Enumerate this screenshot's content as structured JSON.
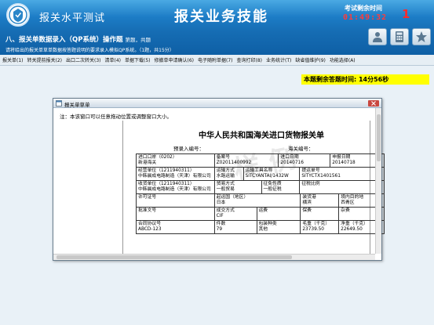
{
  "header": {
    "brand": "报关水平测试",
    "title": "报关业务技能",
    "timer_label": "考试剩余时间",
    "timer_value": "01:49:32",
    "question_number": "1"
  },
  "section": {
    "title": "八、报关单数据录入（QP系统）操作题",
    "meta": "第题，共题",
    "instruction": "请将给出的报关单草单数据按答题说明的要求录入模拟QP系统。（1题，共15分）",
    "tools": [
      "user-icon",
      "calculator-icon",
      "star-icon"
    ]
  },
  "menu": [
    "报关单(1)",
    "转关提前报关(2)",
    "出口二次转关(3)",
    "清单(4)",
    "单据下载(5)",
    "修撤单申请确认(6)",
    "电子随附单据(7)",
    "查询打印(8)",
    "业务统计(T)",
    "缺省值维护(9)",
    "功能选择(A)"
  ],
  "remaining": "本题剩余答题时间:  14分56秒",
  "window": {
    "title": "报关单草单",
    "note": "注：本该窗口可以任意拖动位置或调整窗口大小。",
    "doc_title": "中华人民共和国海关进口货物报关单",
    "pre_entry": "预录入编号：",
    "customs_no": "海关编号：",
    "watermark": "样 例",
    "rows": [
      [
        {
          "label": "进口口岸（0202）",
          "value": "新港海关",
          "w": 100
        },
        {
          "label": "备案号",
          "value": "Z02011400992",
          "w": 82
        },
        {
          "label": "进口日期",
          "value": "20140716",
          "w": 66
        },
        {
          "label": "申报日期",
          "value": "20140718",
          "w": 69
        }
      ],
      [
        {
          "label": "经营单位（1211940311）",
          "value": "中韩晨成电路制造（天津）有限公司",
          "w": 100
        },
        {
          "label": "运输方式",
          "value": "水路运输",
          "w": 37
        },
        {
          "label": "运输工具名称",
          "value": "SITCYANTAI/1432W",
          "w": 72
        },
        {
          "label": "提运单号",
          "value": "SITYCTX1401561",
          "w": 108
        }
      ],
      [
        {
          "label": "收货单位（1211940311）",
          "value": "中韩晨成电路制造（天津）有限公司",
          "w": 100
        },
        {
          "label": "贸易方式",
          "value": "一般贸易",
          "w": 60
        },
        {
          "label": "征免性质",
          "value": "一般征税",
          "w": 49
        },
        {
          "label": "征税比例",
          "value": "",
          "w": 108
        }
      ],
      [
        {
          "label": "许可证号",
          "value": "",
          "w": 100
        },
        {
          "label": "起运国（地区）",
          "value": "日本",
          "w": 110
        },
        {
          "label": "装货港",
          "value": "横滨",
          "w": 49
        },
        {
          "label": "境内目的地",
          "value": "西青区",
          "w": 58
        }
      ],
      [
        {
          "label": "批准文号",
          "value": "",
          "w": 100
        },
        {
          "label": "成交方式",
          "value": "CIF",
          "w": 54
        },
        {
          "label": "运费",
          "value": "",
          "w": 56
        },
        {
          "label": "保费",
          "value": "",
          "w": 49
        },
        {
          "label": "杂费",
          "value": "",
          "w": 58
        }
      ],
      [
        {
          "label": "合同协议号",
          "value": "ABCD-123",
          "w": 100
        },
        {
          "label": "件数",
          "value": "79",
          "w": 54
        },
        {
          "label": "包装种类",
          "value": "其他",
          "w": 56
        },
        {
          "label": "毛重（千克）",
          "value": "23739.50",
          "w": 49
        },
        {
          "label": "净重（千克）",
          "value": "22649.50",
          "w": 58
        }
      ]
    ]
  }
}
